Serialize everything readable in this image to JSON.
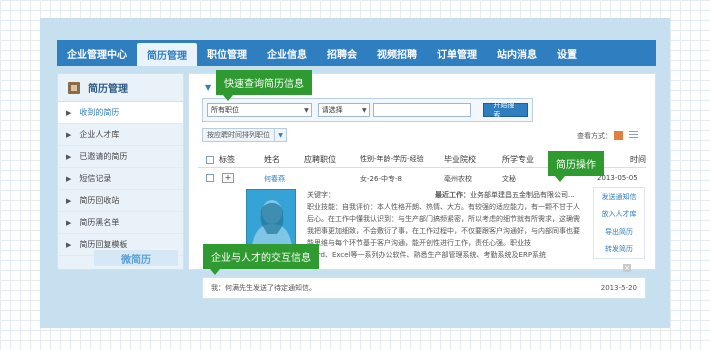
{
  "nav": [
    "企业管理中心",
    "简历管理",
    "职位管理",
    "企业信息",
    "招聘会",
    "视频招聘",
    "订单管理",
    "站内消息",
    "设置"
  ],
  "active_nav": "简历管理",
  "sidebar": {
    "title": "简历管理",
    "items": [
      "收到的简历",
      "企业人才库",
      "已邀请的简历",
      "短信记录",
      "简历回收站",
      "简历黑名单",
      "简历回复模板"
    ],
    "active": "收到的简历",
    "banner_text": "微简历"
  },
  "search": {
    "position_select": "所有职位",
    "status_select": "请选择",
    "keyword_value": "",
    "button": "开始搜索"
  },
  "sort_button": "按应聘时间排列职位",
  "view_mode_label": "查看方式：",
  "table": {
    "headers": [
      "标签",
      "姓名",
      "应聘职位",
      "性别-年龄-学历-经验",
      "毕业院校",
      "所学专业",
      "时间"
    ],
    "row": {
      "name": "何春燕",
      "basic": "女-26-中专-8",
      "school": "亳州农校",
      "major": "文秘",
      "date": "2013-05-05"
    },
    "detail": {
      "keywords_label": "关键字：",
      "recent_work_label": "最近工作：",
      "recent_work": "业务部单建昌五金制品有限公司...",
      "lines": [
        "职业技能：自我评价：本人性格开朗、热情、大方。有较强的适应能力，有一颗不甘于人",
        "后心。在工作中懂我认识到：与生产部门搞频紧密，所以考虑的细节就有所需求，这确需",
        "我把事更加细致，不会敷衍了事，在工作过程中，不仅要跟客户沟通好，与内部同事也要",
        "能思维与每个环节基于客户沟通，能开创性进行工作，责任心强。职业技",
        "Word、Excel等一系列办公软件、熟悉生产部管理系统、考勤系统及ERP系统"
      ]
    }
  },
  "actions": [
    "发送通知信",
    "放入人才库",
    "导出简历",
    "转发简历"
  ],
  "interaction": {
    "message": "我：何满先生发送了待定通知信。",
    "date": "2013-5-20"
  },
  "callouts": {
    "search": "快速查询简历信息",
    "operations": "简历操作",
    "interaction": "企业与人才的交互信息"
  }
}
